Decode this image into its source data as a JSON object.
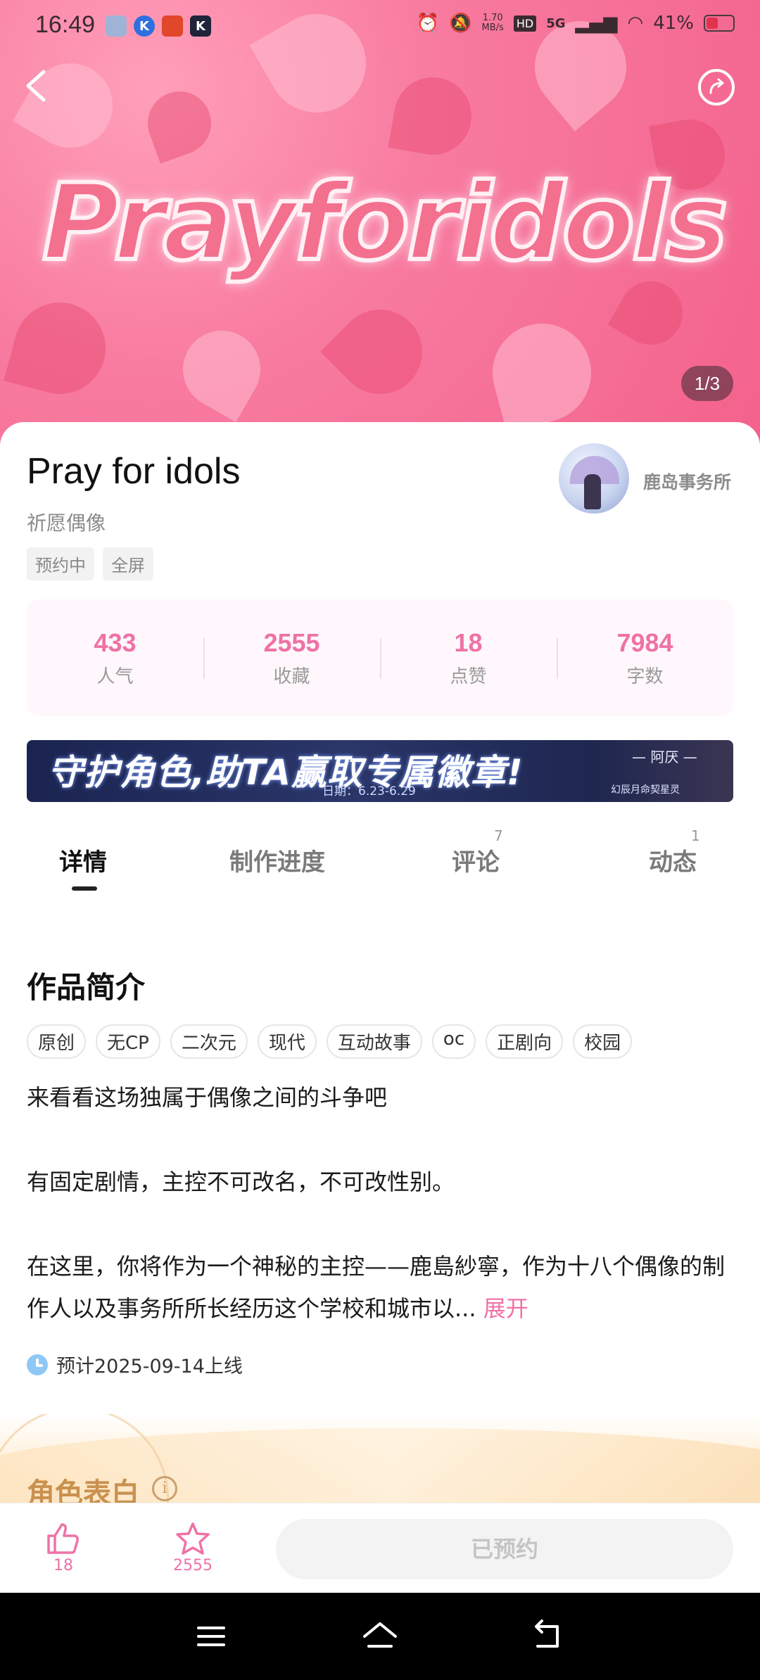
{
  "status_bar": {
    "time": "16:49",
    "speed_value": "1.70",
    "speed_unit": "MB/s",
    "hd": "HD",
    "network": "5G",
    "battery": "41%"
  },
  "hero": {
    "title_art": "Prayforidols",
    "page_indicator": "1/3"
  },
  "work": {
    "title": "Pray for idols",
    "subtitle": "祈愿偶像",
    "tags": [
      "预约中",
      "全屏"
    ]
  },
  "author": {
    "name": "鹿岛事务所"
  },
  "stats": [
    {
      "value": "433",
      "label": "人气"
    },
    {
      "value": "2555",
      "label": "收藏"
    },
    {
      "value": "18",
      "label": "点赞"
    },
    {
      "value": "7984",
      "label": "字数"
    }
  ],
  "banner": {
    "text": "守护角色,助TA赢取专属徽章!",
    "date": "日期：6.23-6.29",
    "character": "— 阿厌 —",
    "subtitle": "幻辰月命契星灵"
  },
  "tabs": [
    {
      "label": "详情",
      "count": ""
    },
    {
      "label": "制作进度",
      "count": ""
    },
    {
      "label": "评论",
      "count": "7"
    },
    {
      "label": "动态",
      "count": "1"
    }
  ],
  "intro": {
    "title": "作品简介",
    "genres": [
      "原创",
      "无CP",
      "二次元",
      "现代",
      "互动故事",
      "oc",
      "正剧向",
      "校园"
    ],
    "lines": [
      "来看看这场独属于偶像之间的斗争吧",
      "有固定剧情，主控不可改名，不可改性别。",
      "在这里，你将作为一个神秘的主控——鹿島紗寧，作为十八个偶像的制作人以及事务所所长经历这个学校和城市以..."
    ],
    "expand": "展开",
    "release": "预计2025-09-14上线"
  },
  "role_section": {
    "title": "角色表白",
    "info": "i"
  },
  "bottom_bar": {
    "likes": "18",
    "favorites": "2555",
    "reserved": "已预约"
  },
  "colors": {
    "accent": "#ef72a6",
    "hero_pink": "#f87ba0",
    "role_gold": "#c9914e"
  }
}
